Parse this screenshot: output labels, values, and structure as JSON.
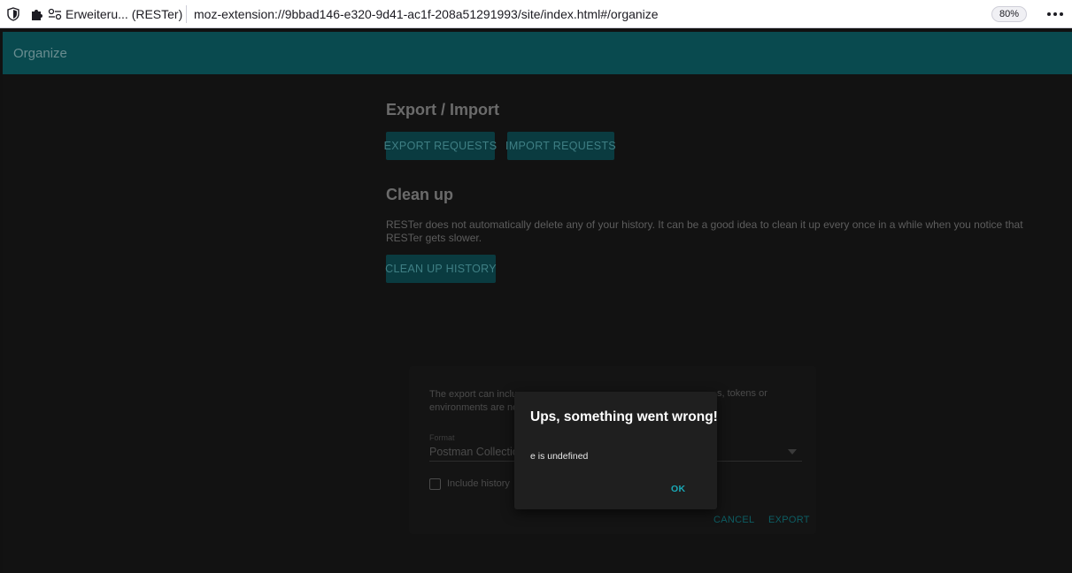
{
  "browser": {
    "extension_name": "Erweiteru... (RESTer)",
    "url": "moz-extension://9bbad146-e320-9d41-ac1f-208a51291993/site/index.html#/organize",
    "zoom": "80%",
    "icons": [
      "shield-icon",
      "puzzle-icon",
      "permissions-icon",
      "more-menu-icon"
    ]
  },
  "appbar": {
    "title": "Organize"
  },
  "export_import": {
    "title": "Export / Import",
    "export_button": "EXPORT REQUESTS",
    "import_button": "IMPORT REQUESTS"
  },
  "clean_up": {
    "title": "Clean up",
    "description_line1": "RESTer does not automatically delete any of your history. It can be a good idea to clean it up every once in a while when you notice that",
    "description_line2": "RESTer gets slower.",
    "button": "CLEAN UP HISTORY"
  },
  "export_dialog": {
    "info_line1": "The export can inclu",
    "info_line2": "environments are no",
    "info_right": "s, tokens or",
    "format_label": "Format",
    "format_value": "Postman Collectio",
    "include_history_label": "Include history",
    "include_history_checked": false,
    "cancel_button": "CANCEL",
    "export_button": "EXPORT"
  },
  "error_dialog": {
    "title": "Ups, something went wrong!",
    "message": "e is undefined",
    "ok_button": "OK"
  },
  "colors": {
    "appbar": "#094a4f",
    "accent": "#19a8b6",
    "background": "#121212"
  }
}
